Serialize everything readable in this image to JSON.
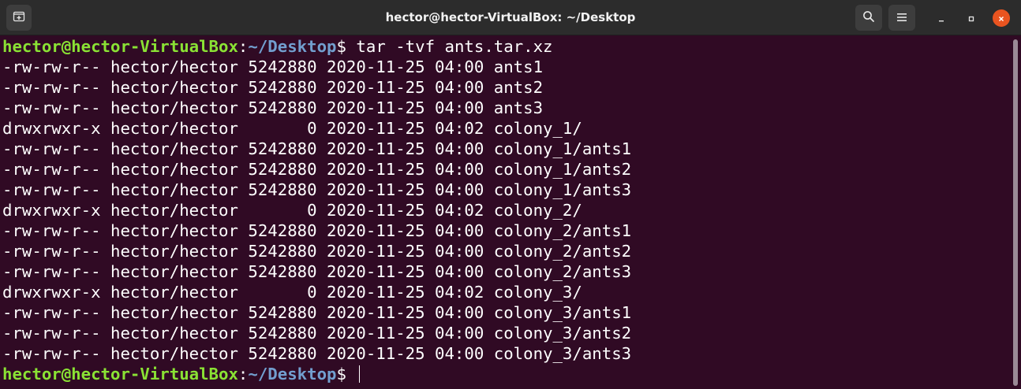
{
  "window": {
    "title": "hector@hector-VirtualBox: ~/Desktop"
  },
  "icons": {
    "new_tab": "new-tab-icon",
    "search": "search-icon",
    "menu": "hamburger-menu-icon",
    "minimize": "minimize-icon",
    "maximize": "maximize-icon",
    "close": "close-icon"
  },
  "colors": {
    "background": "#300a24",
    "prompt_user": "#8ae234",
    "prompt_path": "#729fcf",
    "close_button": "#e95420"
  },
  "terminal": {
    "prompt1": {
      "user": "hector@hector-VirtualBox",
      "sep": ":",
      "path": "~/Desktop",
      "tail": "$ tar -tvf ants.tar.xz"
    },
    "output": [
      "-rw-rw-r-- hector/hector 5242880 2020-11-25 04:00 ants1",
      "-rw-rw-r-- hector/hector 5242880 2020-11-25 04:00 ants2",
      "-rw-rw-r-- hector/hector 5242880 2020-11-25 04:00 ants3",
      "drwxrwxr-x hector/hector       0 2020-11-25 04:02 colony_1/",
      "-rw-rw-r-- hector/hector 5242880 2020-11-25 04:00 colony_1/ants1",
      "-rw-rw-r-- hector/hector 5242880 2020-11-25 04:00 colony_1/ants2",
      "-rw-rw-r-- hector/hector 5242880 2020-11-25 04:00 colony_1/ants3",
      "drwxrwxr-x hector/hector       0 2020-11-25 04:02 colony_2/",
      "-rw-rw-r-- hector/hector 5242880 2020-11-25 04:00 colony_2/ants1",
      "-rw-rw-r-- hector/hector 5242880 2020-11-25 04:00 colony_2/ants2",
      "-rw-rw-r-- hector/hector 5242880 2020-11-25 04:00 colony_2/ants3",
      "drwxrwxr-x hector/hector       0 2020-11-25 04:02 colony_3/",
      "-rw-rw-r-- hector/hector 5242880 2020-11-25 04:00 colony_3/ants1",
      "-rw-rw-r-- hector/hector 5242880 2020-11-25 04:00 colony_3/ants2",
      "-rw-rw-r-- hector/hector 5242880 2020-11-25 04:00 colony_3/ants3"
    ],
    "prompt2": {
      "user": "hector@hector-VirtualBox",
      "sep": ":",
      "path": "~/Desktop",
      "tail": "$ "
    }
  }
}
